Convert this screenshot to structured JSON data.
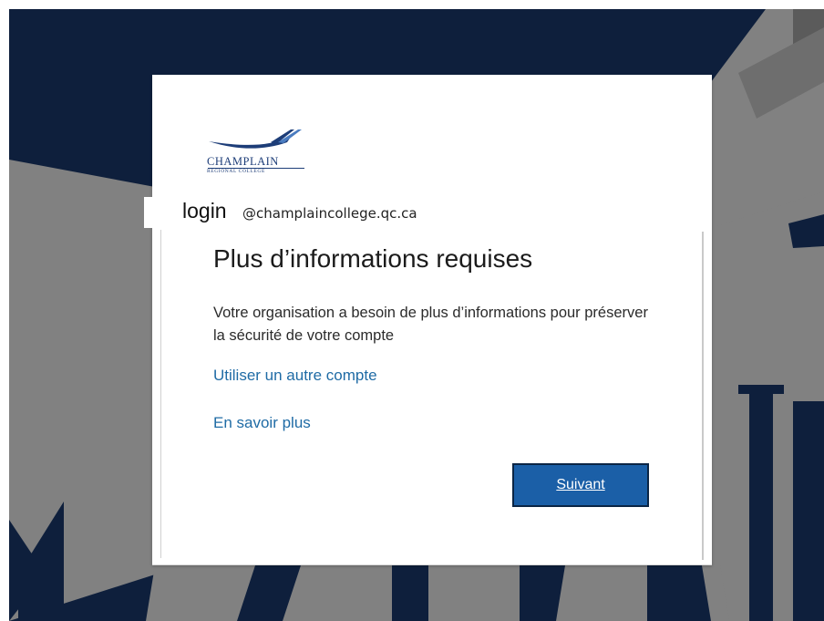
{
  "background": {
    "colors": {
      "navy": "#0e1f3c",
      "gray": "#818181",
      "dark_gray": "#5b5b5b"
    }
  },
  "logo": {
    "name": "CHAMPLAIN",
    "subtitle": "REGIONAL COLLEGE",
    "color": "#1d3d78"
  },
  "account": {
    "username": "login",
    "domain": "@champlaincollege.qc.ca"
  },
  "dialog": {
    "title": "Plus d’informations requises",
    "description": "Votre organisation a besoin de plus d’informations pour préserver la sécurité de votre compte",
    "use_other_account": "Utiliser un autre compte",
    "learn_more": "En savoir plus",
    "next_button": "Suivant",
    "accent_color": "#1b5fa7",
    "link_color": "#1f6ba5"
  }
}
